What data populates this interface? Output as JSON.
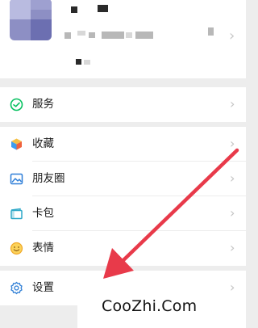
{
  "menu": {
    "services": {
      "label": "服务",
      "icon": "wechat-pay-icon"
    },
    "favorites": {
      "label": "收藏",
      "icon": "favorites-cube-icon"
    },
    "moments": {
      "label": "朋友圈",
      "icon": "moments-picture-icon"
    },
    "cards": {
      "label": "卡包",
      "icon": "card-wallet-icon"
    },
    "stickers": {
      "label": "表情",
      "icon": "smiley-face-icon"
    },
    "settings": {
      "label": "设置",
      "icon": "gear-icon"
    }
  },
  "colors": {
    "accent_arrow": "#e83a4a",
    "green": "#07c160",
    "page_bg": "#ededed"
  },
  "watermark": {
    "text": "CooZhi.Com"
  }
}
